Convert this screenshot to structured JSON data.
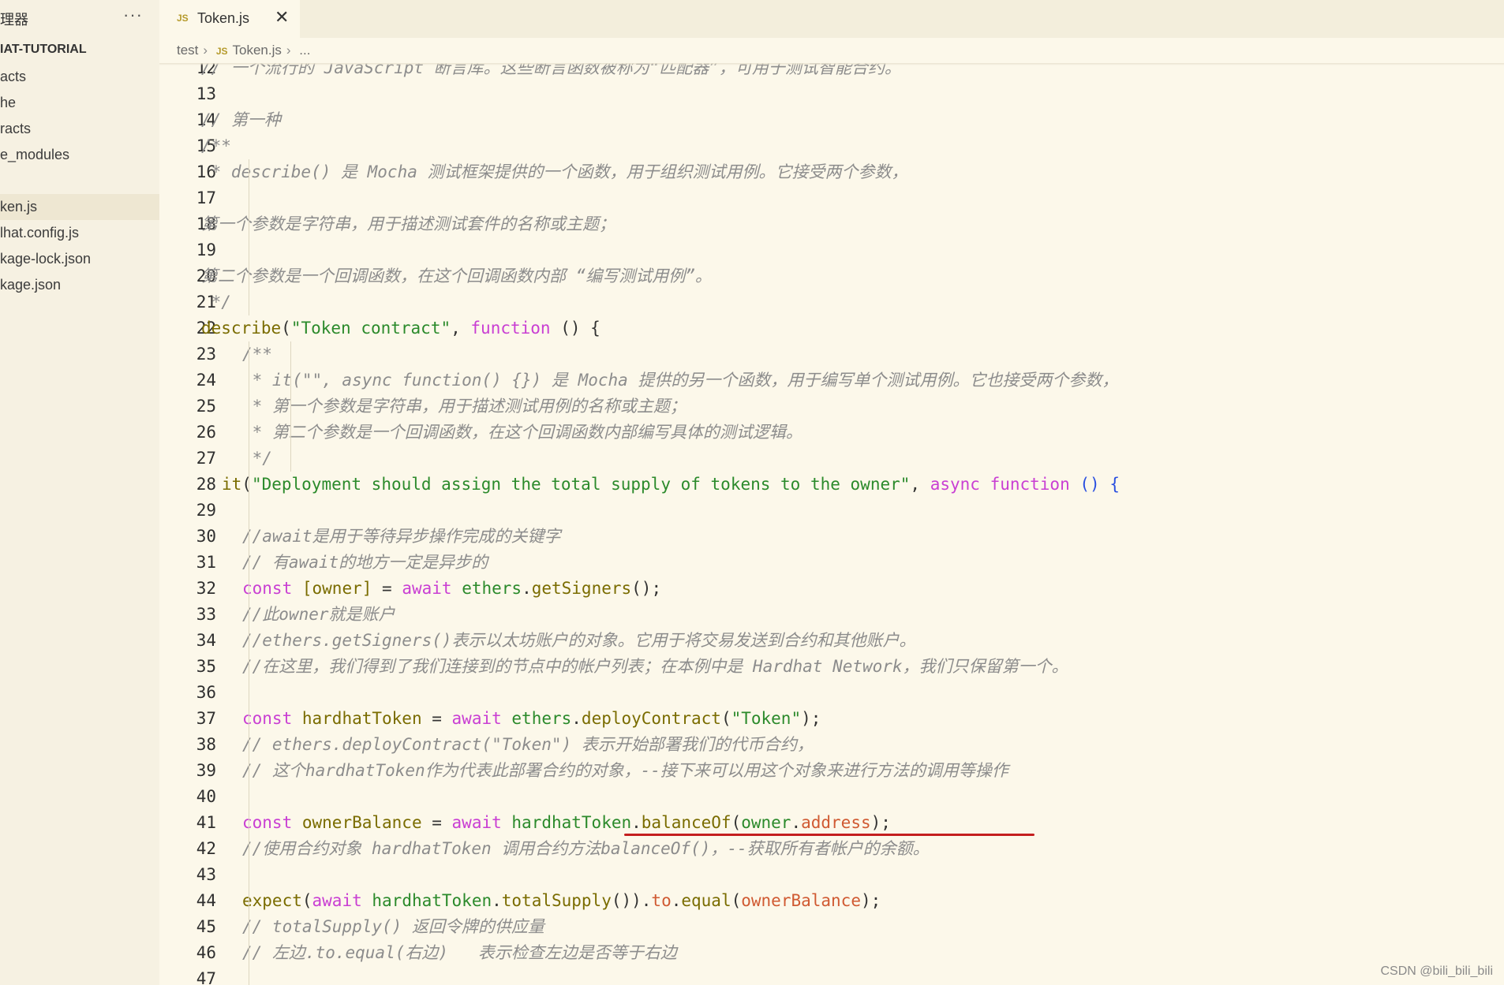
{
  "sidebar": {
    "title": "理器",
    "more_icon": "ellipsis-icon",
    "section": "IAT-TUTORIAL",
    "items": [
      {
        "label": "acts",
        "active": false
      },
      {
        "label": "he",
        "active": false
      },
      {
        "label": "racts",
        "active": false
      },
      {
        "label": "e_modules",
        "active": false
      },
      {
        "label": "",
        "active": false
      },
      {
        "label": "ken.js",
        "active": true
      },
      {
        "label": "lhat.config.js",
        "active": false
      },
      {
        "label": "kage-lock.json",
        "active": false
      },
      {
        "label": "kage.json",
        "active": false
      }
    ]
  },
  "tab": {
    "icon_text": "JS",
    "label": "Token.js",
    "close": "✕"
  },
  "breadcrumb": {
    "folder": "test",
    "js_icon": "JS",
    "file": "Token.js",
    "more": "..."
  },
  "lines": [
    {
      "n": "12",
      "indent": 0,
      "tokens": [
        [
          "comment",
          "// 一个流行的 JavaScript 断言库。这些断言函数被称为“匹配器”，可用于测试智能合约。"
        ]
      ]
    },
    {
      "n": "13",
      "indent": 0,
      "tokens": []
    },
    {
      "n": "14",
      "indent": 0,
      "tokens": [
        [
          "comment",
          "// 第一种"
        ]
      ]
    },
    {
      "n": "15",
      "indent": 0,
      "tokens": [
        [
          "comment",
          "/**"
        ]
      ]
    },
    {
      "n": "16",
      "indent": 0,
      "tokens": [
        [
          "comment",
          " * describe() 是 Mocha 测试框架提供的一个函数，用于组织测试用例。它接受两个参数，"
        ]
      ]
    },
    {
      "n": "17",
      "indent": 0,
      "tokens": []
    },
    {
      "n": "18",
      "indent": 0,
      "tokens": [
        [
          "comment",
          "第一个参数是字符串，用于描述测试套件的名称或主题；"
        ]
      ]
    },
    {
      "n": "19",
      "indent": 0,
      "tokens": []
    },
    {
      "n": "20",
      "indent": 0,
      "tokens": [
        [
          "comment",
          "第二个参数是一个回调函数，在这个回调函数内部 “编写测试用例”。"
        ]
      ]
    },
    {
      "n": "21",
      "indent": 0,
      "tokens": [
        [
          "comment",
          " */"
        ]
      ]
    },
    {
      "n": "22",
      "indent": 0,
      "tokens": [
        [
          "fn",
          "describe"
        ],
        [
          "plain",
          "("
        ],
        [
          "str",
          "\"Token contract\""
        ],
        [
          "plain",
          ", "
        ],
        [
          "kw",
          "function"
        ],
        [
          "plain",
          " () {"
        ]
      ]
    },
    {
      "n": "23",
      "indent": 2,
      "tokens": [
        [
          "comment",
          "/**"
        ]
      ]
    },
    {
      "n": "24",
      "indent": 2,
      "tokens": [
        [
          "comment",
          " * it(\"\", async function() {}) 是 Mocha 提供的另一个函数，用于编写单个测试用例。它也接受两个参数，"
        ]
      ]
    },
    {
      "n": "25",
      "indent": 2,
      "tokens": [
        [
          "comment",
          " * 第一个参数是字符串，用于描述测试用例的名称或主题；"
        ]
      ]
    },
    {
      "n": "26",
      "indent": 2,
      "tokens": [
        [
          "comment",
          " * 第二个参数是一个回调函数，在这个回调函数内部编写具体的测试逻辑。"
        ]
      ]
    },
    {
      "n": "27",
      "indent": 2,
      "tokens": [
        [
          "comment",
          " */"
        ]
      ]
    },
    {
      "n": "28",
      "indent": 1,
      "tokens": [
        [
          "fn",
          "it"
        ],
        [
          "plain",
          "("
        ],
        [
          "str",
          "\"Deployment should assign the total supply of tokens to the owner\""
        ],
        [
          "plain",
          ", "
        ],
        [
          "kw",
          "async"
        ],
        [
          "plain",
          " "
        ],
        [
          "kw",
          "function"
        ],
        [
          "plain",
          " "
        ],
        [
          "blue",
          "() {"
        ]
      ]
    },
    {
      "n": "29",
      "indent": 0,
      "tokens": []
    },
    {
      "n": "30",
      "indent": 2,
      "tokens": [
        [
          "comment",
          "//await是用于等待异步操作完成的关键字"
        ]
      ]
    },
    {
      "n": "31",
      "indent": 2,
      "tokens": [
        [
          "comment",
          "// 有await的地方一定是异步的"
        ]
      ]
    },
    {
      "n": "32",
      "indent": 2,
      "tokens": [
        [
          "kw",
          "const"
        ],
        [
          "plain",
          " "
        ],
        [
          "fn",
          "[owner]"
        ],
        [
          "plain",
          " = "
        ],
        [
          "kw",
          "await"
        ],
        [
          "plain",
          " "
        ],
        [
          "str",
          "ethers"
        ],
        [
          "plain",
          "."
        ],
        [
          "fn",
          "getSigners"
        ],
        [
          "plain",
          "();"
        ]
      ]
    },
    {
      "n": "33",
      "indent": 2,
      "tokens": [
        [
          "comment",
          "//此owner就是账户"
        ]
      ]
    },
    {
      "n": "34",
      "indent": 2,
      "tokens": [
        [
          "comment",
          "//ethers.getSigners()表示以太坊账户的对象。它用于将交易发送到合约和其他账户。"
        ]
      ]
    },
    {
      "n": "35",
      "indent": 2,
      "tokens": [
        [
          "comment",
          "//在这里，我们得到了我们连接到的节点中的帐户列表；在本例中是 Hardhat Network，我们只保留第一个。"
        ]
      ]
    },
    {
      "n": "36",
      "indent": 0,
      "tokens": []
    },
    {
      "n": "37",
      "indent": 2,
      "tokens": [
        [
          "kw",
          "const"
        ],
        [
          "plain",
          " "
        ],
        [
          "fn",
          "hardhatToken"
        ],
        [
          "plain",
          " = "
        ],
        [
          "kw",
          "await"
        ],
        [
          "plain",
          " "
        ],
        [
          "str",
          "ethers"
        ],
        [
          "plain",
          "."
        ],
        [
          "fn",
          "deployContract"
        ],
        [
          "plain",
          "("
        ],
        [
          "str",
          "\"Token\""
        ],
        [
          "plain",
          ");"
        ]
      ]
    },
    {
      "n": "38",
      "indent": 2,
      "tokens": [
        [
          "comment",
          "// ethers.deployContract(\"Token\") 表示开始部署我们的代币合约，"
        ]
      ]
    },
    {
      "n": "39",
      "indent": 2,
      "tokens": [
        [
          "comment",
          "// 这个hardhatToken作为代表此部署合约的对象，--接下来可以用这个对象来进行方法的调用等操作"
        ]
      ]
    },
    {
      "n": "40",
      "indent": 0,
      "tokens": []
    },
    {
      "n": "41",
      "indent": 2,
      "tokens": [
        [
          "kw",
          "const"
        ],
        [
          "plain",
          " "
        ],
        [
          "fn",
          "ownerBalance"
        ],
        [
          "plain",
          " = "
        ],
        [
          "kw",
          "await"
        ],
        [
          "plain",
          " "
        ],
        [
          "str",
          "hardhatToken"
        ],
        [
          "plain",
          "."
        ],
        [
          "fn",
          "balanceOf"
        ],
        [
          "plain",
          "("
        ],
        [
          "str",
          "owner"
        ],
        [
          "plain",
          "."
        ],
        [
          "var",
          "address"
        ],
        [
          "plain",
          ");"
        ]
      ]
    },
    {
      "n": "42",
      "indent": 2,
      "tokens": [
        [
          "comment",
          "//使用合约对象 hardhatToken 调用合约方法balanceOf()，--获取所有者帐户的余额。"
        ]
      ]
    },
    {
      "n": "43",
      "indent": 0,
      "tokens": []
    },
    {
      "n": "44",
      "indent": 2,
      "tokens": [
        [
          "fn",
          "expect"
        ],
        [
          "plain",
          "("
        ],
        [
          "kw",
          "await"
        ],
        [
          "plain",
          " "
        ],
        [
          "str",
          "hardhatToken"
        ],
        [
          "plain",
          "."
        ],
        [
          "fn",
          "totalSupply"
        ],
        [
          "plain",
          "())."
        ],
        [
          "var",
          "to"
        ],
        [
          "plain",
          "."
        ],
        [
          "fn",
          "equal"
        ],
        [
          "plain",
          "("
        ],
        [
          "var",
          "ownerBalance"
        ],
        [
          "plain",
          ");"
        ]
      ]
    },
    {
      "n": "45",
      "indent": 2,
      "tokens": [
        [
          "comment",
          "// totalSupply() 返回令牌的供应量"
        ]
      ]
    },
    {
      "n": "46",
      "indent": 2,
      "tokens": [
        [
          "comment",
          "// 左边.to.equal(右边)   表示检查左边是否等于右边"
        ]
      ]
    },
    {
      "n": "47",
      "indent": 0,
      "tokens": []
    }
  ],
  "watermark": "CSDN @bili_bili_bili"
}
